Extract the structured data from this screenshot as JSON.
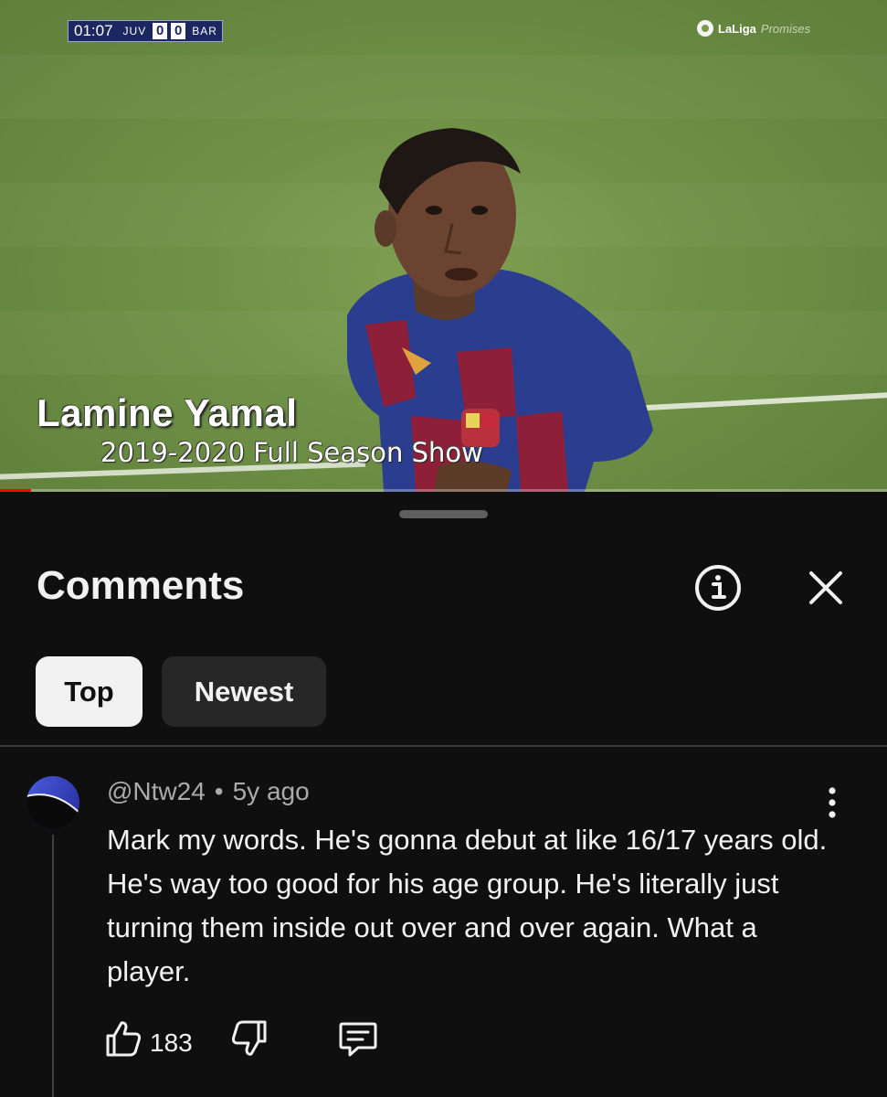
{
  "video": {
    "scorebug": {
      "time": "01:07",
      "home": "JUV",
      "home_score": "0",
      "away_score": "0",
      "away": "BAR"
    },
    "watermark": {
      "brand": "LaLiga",
      "sub": "Promises"
    },
    "title": "Lamine Yamal",
    "subtitle": "2019-2020 Full Season Show",
    "progress": 0.035,
    "colors": {
      "progress": "#ff0000"
    }
  },
  "comments_panel": {
    "title": "Comments",
    "filters": [
      {
        "label": "Top",
        "selected": true
      },
      {
        "label": "Newest",
        "selected": false
      }
    ],
    "comments": [
      {
        "author": "@Ntw24",
        "separator": "•",
        "time": "5y ago",
        "text": "Mark my words. He's gonna debut at like 16/17 years old. He's way too good for his age group. He's literally just turning them inside out over and over again. What a player.",
        "likes": "183"
      }
    ]
  },
  "icons": [
    "info-icon",
    "close-icon",
    "more-vertical-icon",
    "thumbs-up-icon",
    "thumbs-down-icon",
    "reply-icon"
  ]
}
